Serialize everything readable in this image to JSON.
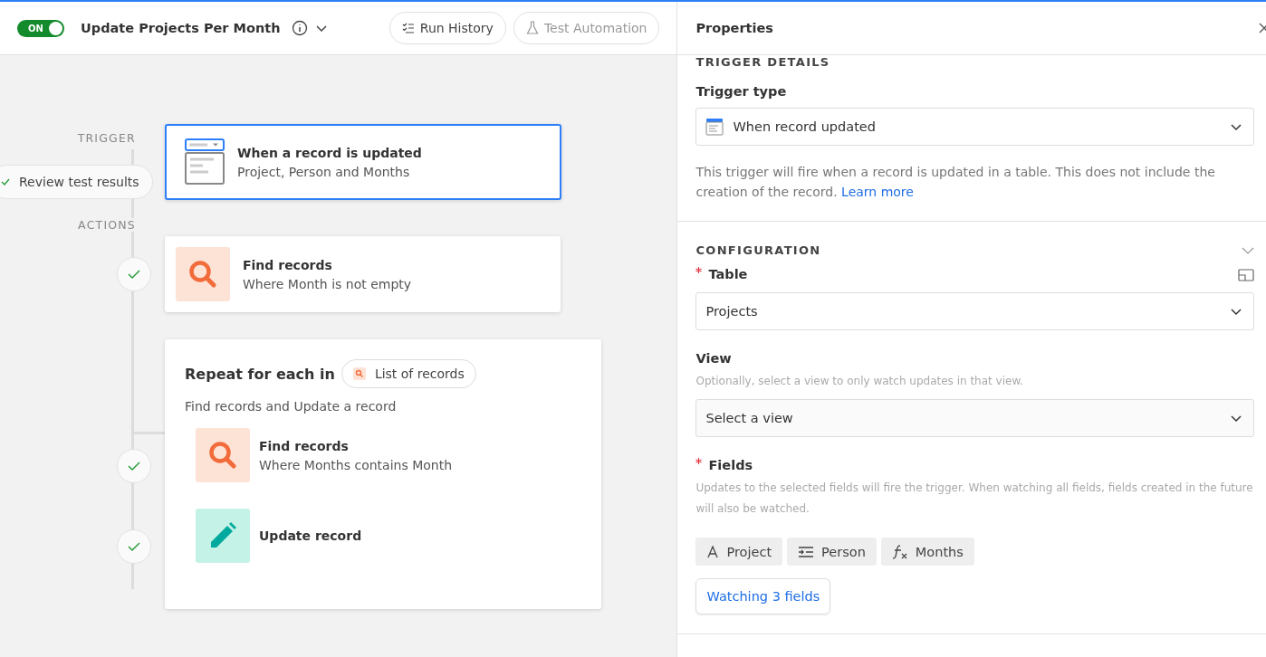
{
  "toolbar": {
    "toggle": {
      "label": "ON",
      "on": true
    },
    "title": "Update Projects Per Month",
    "buttons": [
      {
        "label": "Run History",
        "kind": "history",
        "disabled": false
      },
      {
        "label": "Test Automation",
        "kind": "test",
        "disabled": true
      }
    ]
  },
  "canvas": {
    "trigger_label": "TRIGGER",
    "actions_label": "ACTIONS",
    "review_button": "Review test results",
    "trigger": {
      "title": "When a record is updated",
      "subtitle": "Project, Person and Months",
      "selected": true
    },
    "actions": [
      {
        "kind": "find",
        "title": "Find records",
        "subtitle": "Where Month is not empty",
        "done": true
      }
    ],
    "repeat": {
      "title": "Repeat for each in",
      "token": "List of records",
      "subtitle": "Find records and Update a record",
      "steps": [
        {
          "kind": "find",
          "title": "Find records",
          "subtitle": "Where Months contains Month",
          "done": true
        },
        {
          "kind": "update",
          "title": "Update record",
          "done": true
        }
      ]
    }
  },
  "properties": {
    "title": "Properties",
    "trigger_details": {
      "heading": "TRIGGER DETAILS",
      "trigger_type_label": "Trigger type",
      "trigger_type_value": "When record updated",
      "description": "This trigger will fire when a record is updated in a table. This does not include the creation of the record.",
      "link": "Learn more"
    },
    "configuration": {
      "heading": "CONFIGURATION",
      "table_label": "Table",
      "table_required": true,
      "table_value": "Projects",
      "view_label": "View",
      "view_required": false,
      "view_hint": "Optionally, select a view to only watch updates in that view.",
      "view_placeholder": "Select a view",
      "fields_label": "Fields",
      "fields_required": true,
      "fields_hint": "Updates to the selected fields will fire the trigger. When watching all fields, fields created in the future will also be watched.",
      "fields": [
        {
          "kind": "text",
          "label": "Project"
        },
        {
          "kind": "lines",
          "label": "Person"
        },
        {
          "kind": "formula",
          "label": "Months"
        }
      ],
      "watching_button": "Watching 3 fields"
    }
  }
}
